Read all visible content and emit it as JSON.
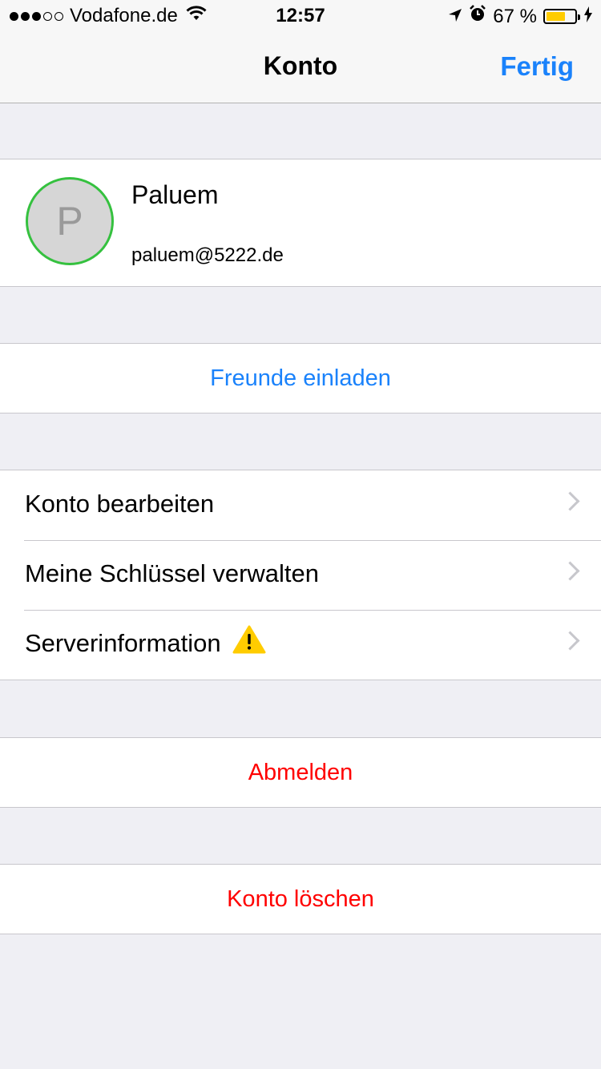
{
  "status_bar": {
    "signal_dots_filled": 3,
    "signal_dots_total": 5,
    "carrier": "Vodafone.de",
    "time": "12:57",
    "battery_percent": "67 %",
    "battery_level": 0.67,
    "icons": [
      "wifi-icon",
      "location-arrow-icon",
      "alarm-icon",
      "battery-icon",
      "charging-bolt-icon"
    ]
  },
  "nav": {
    "title": "Konto",
    "done_label": "Fertig"
  },
  "profile": {
    "avatar_initial": "P",
    "name": "Paluem",
    "email": "paluem@5222.de"
  },
  "invite": {
    "label": "Freunde einladen"
  },
  "menu": {
    "items": [
      {
        "label": "Konto bearbeiten"
      },
      {
        "label": "Meine Schlüssel verwalten"
      },
      {
        "label": "Serverinformation",
        "icon": "warning-icon"
      }
    ]
  },
  "logout": {
    "label": "Abmelden"
  },
  "delete_account": {
    "label": "Konto löschen"
  },
  "colors": {
    "accent_blue": "#1a82fb",
    "destructive_red": "#ff0000",
    "avatar_ring_green": "#35c13f",
    "battery_yellow": "#ffcc00",
    "warning_yellow": "#ffcc00"
  }
}
